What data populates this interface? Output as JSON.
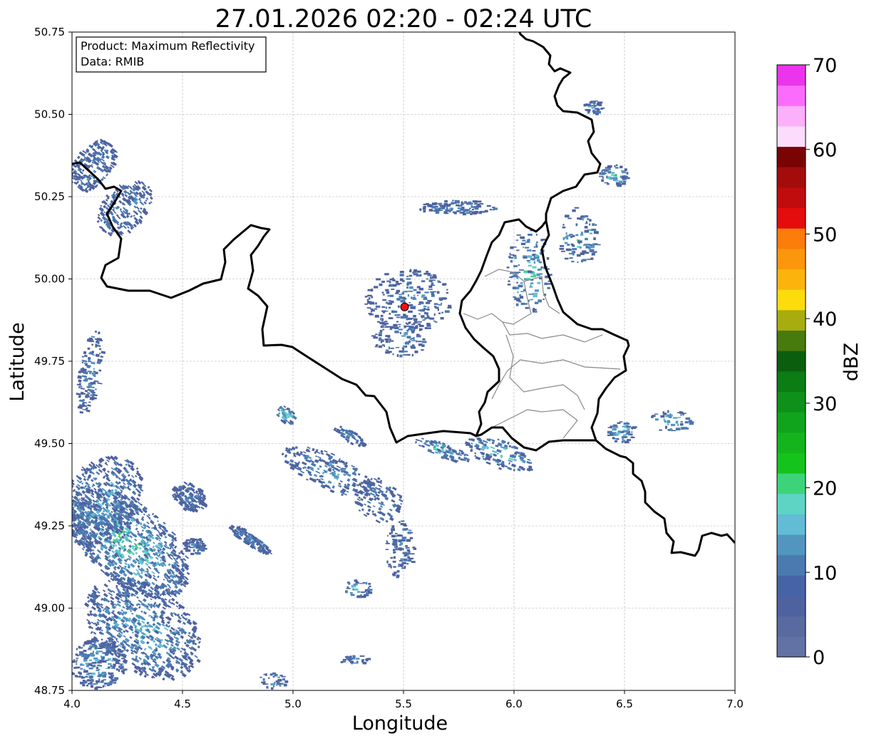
{
  "title": "27.01.2026 02:20 - 02:24 UTC",
  "info_box": {
    "product_line": "Product: Maximum Reflectivity",
    "data_line": "Data: RMIB"
  },
  "x_axis": {
    "label": "Longitude",
    "ticks": [
      "4.0",
      "4.5",
      "5.0",
      "5.5",
      "6.0",
      "6.5",
      "7.0"
    ]
  },
  "y_axis": {
    "label": "Latitude",
    "ticks": [
      "48.75",
      "49.00",
      "49.25",
      "49.50",
      "49.75",
      "50.00",
      "50.25",
      "50.50",
      "50.75"
    ]
  },
  "colorbar": {
    "label": "dBZ",
    "ticks": [
      "0",
      "10",
      "20",
      "30",
      "40",
      "50",
      "60",
      "70"
    ],
    "range": [
      0,
      70
    ],
    "colors": [
      "#6272a4",
      "#586aa0",
      "#4e62a0",
      "#4663a6",
      "#4a7ab0",
      "#5296c0",
      "#62bcd6",
      "#5ed4c4",
      "#3cd47a",
      "#14c41c",
      "#14b41c",
      "#10a41c",
      "#0e901a",
      "#0c7c14",
      "#0a5e0e",
      "#487a0c",
      "#a8ac0e",
      "#fcdc0c",
      "#fcb40c",
      "#fc960c",
      "#fc7c0c",
      "#e40c0c",
      "#c00c0c",
      "#a40c0c",
      "#7a0404",
      "#fcdcfc",
      "#fcb0fc",
      "#fc6cfc",
      "#ec34ec"
    ]
  },
  "map": {
    "lon_range": [
      4.0,
      7.0
    ],
    "lat_range": [
      48.75,
      50.75
    ],
    "radar_site": {
      "lon": 5.505,
      "lat": 49.915,
      "color": "#ee1111"
    }
  }
}
